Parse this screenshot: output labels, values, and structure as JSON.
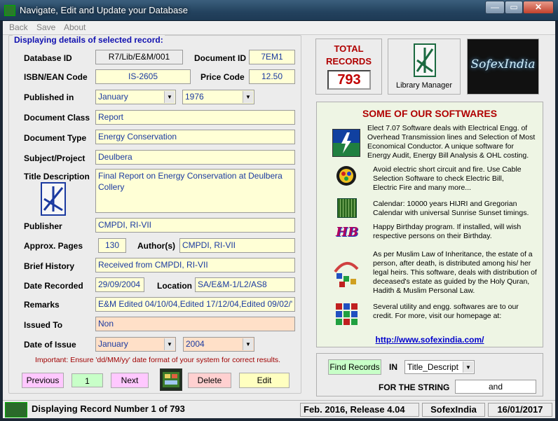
{
  "window": {
    "title": "Navigate, Edit and Update your Database",
    "minimize": "—",
    "maximize": "▭",
    "close": "✕"
  },
  "menu": [
    "Back",
    "Save",
    "About"
  ],
  "record": {
    "legend": "Displaying details of selected record:",
    "database_id_label": "Database ID",
    "database_id": "R7/Lib/E&M/001",
    "document_id_label": "Document ID",
    "document_id": "7EM1",
    "isbn_label": "ISBN/EAN Code",
    "isbn": "IS-2605",
    "price_label": "Price Code",
    "price": "12.50",
    "published_label": "Published in",
    "published_month": "January",
    "published_year": "1976",
    "class_label": "Document Class",
    "class": "Report",
    "type_label": "Document Type",
    "type": "Energy Conservation",
    "subject_label": "Subject/Project",
    "subject": "Deulbera",
    "title_label": "Title Description",
    "title": "Final Report on Energy Conservation at Deulbera Collery",
    "publisher_label": "Publisher",
    "publisher": "CMPDI, RI-VII",
    "pages_label": "Approx. Pages",
    "pages": "130",
    "authors_label": "Author(s)",
    "authors": "CMPDI, RI-VII",
    "history_label": "Brief History",
    "history": "Received from CMPDI, RI-VII",
    "date_recorded_label": "Date Recorded",
    "date_recorded": "29/09/2004",
    "location_label": "Location",
    "location": "SA/E&M-1/L2/AS8",
    "remarks_label": "Remarks",
    "remarks": "E&M Edited 04/10/04,Edited 17/12/04,Edited 09/02/'",
    "issued_label": "Issued To",
    "issued": "Non",
    "doi_label": "Date of Issue",
    "doi_month": "January",
    "doi_year": "2004"
  },
  "note": "Important: Ensure 'dd/MM/yy' date format of your system for correct results.",
  "nav": {
    "previous": "Previous",
    "record_no": "1",
    "next": "Next",
    "delete": "Delete",
    "edit": "Edit"
  },
  "total": {
    "label1": "TOTAL",
    "label2": "RECORDS",
    "count": "793"
  },
  "library_manager": "Library Manager",
  "logo_text": "SofexIndia",
  "softwares": {
    "heading": "SOME OF OUR SOFTWARES",
    "items": [
      "Elect 7.07 Software deals with Electrical Engg. of Overhead Transmission lines and Selection of Most Economical Conductor. A unique software for Energy Audit, Energy Bill Analysis & OHL costing.",
      "Avoid electric short circuit and fire. Use Cable Selection Software to check Electric Bill, Electric Fire and many more...",
      "Calendar: 10000 years HIJRI and Gregorian Calendar with universal Sunrise Sunset timings.",
      "Happy Birthday program. If installed, will wish respective persons on their Birthday.",
      "As per Muslim Law of Inheritance, the estate of a person, after death, is distributed among his/ her legal heirs. This software, deals with distribution of deceased's estate as guided by the Holy Quran, Hadith & Muslim Personal Law.",
      "Several utility and engg. softwares are to our credit. For more, visit our homepage at:"
    ],
    "hb_icon_text": "HB",
    "url": "http://www.sofexindia.com/"
  },
  "search": {
    "find": "Find Records",
    "in": "IN",
    "field": "Title_Descript",
    "for": "FOR THE STRING",
    "string": "and"
  },
  "status": {
    "message": "Displaying Record Number 1 of 793",
    "release": "Feb. 2016, Release 4.04",
    "company": "SofexIndia",
    "date": "16/01/2017"
  },
  "colors": {
    "accent": "#1b3aa0",
    "field_bg": "#ffffd6",
    "pink": "#ffc8ff",
    "green": "#c8ffc8"
  }
}
